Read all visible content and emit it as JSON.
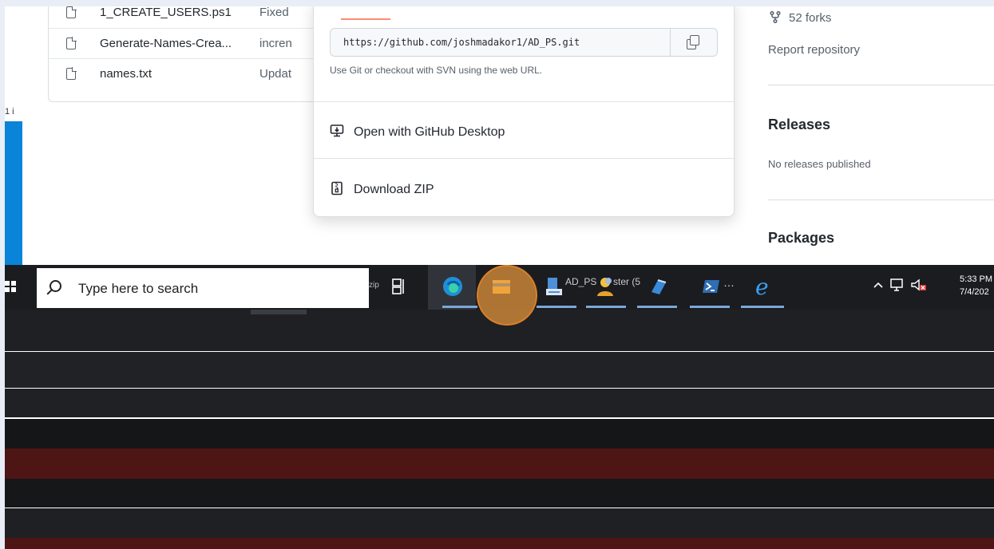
{
  "files": [
    {
      "name": "1_CREATE_USERS.ps1",
      "message": "Fixed"
    },
    {
      "name": "Generate-Names-Crea...",
      "message": "incren"
    },
    {
      "name": "names.txt",
      "message": "Updat"
    }
  ],
  "left_strip_text": "1 i",
  "clone": {
    "url": "https://github.com/joshmadakor1/AD_PS.git",
    "hint": "Use Git or checkout with SVN using the web URL.",
    "open_desktop": "Open with GitHub Desktop",
    "download_zip": "Download ZIP"
  },
  "sidebar": {
    "forks": "52 forks",
    "report": "Report repository",
    "releases_heading": "Releases",
    "releases_text": "No releases published",
    "packages_heading": "Packages"
  },
  "taskbar": {
    "search_placeholder": "Type here to search",
    "hidden_label_1": "zip",
    "hidden_label_2": "AD_PS",
    "hidden_label_3": "ster (5",
    "time": "5:33 PM",
    "date": "7/4/202"
  },
  "colors": {
    "accent_blue": "#0a84d8",
    "highlight": "#ed9a3c",
    "taskbar": "#1a1c20",
    "dark_red": "#4e1515"
  },
  "icons": [
    "file-icon",
    "copy-icon",
    "desktop-icon",
    "zip-icon",
    "fork-icon",
    "search-icon",
    "windows-icon",
    "task-view-icon",
    "edge-icon",
    "file-explorer-icon",
    "server-manager-icon",
    "user-icon",
    "remote-desktop-icon",
    "powershell-icon",
    "internet-explorer-icon",
    "chevron-up-icon",
    "network-icon",
    "volume-muted-icon"
  ]
}
